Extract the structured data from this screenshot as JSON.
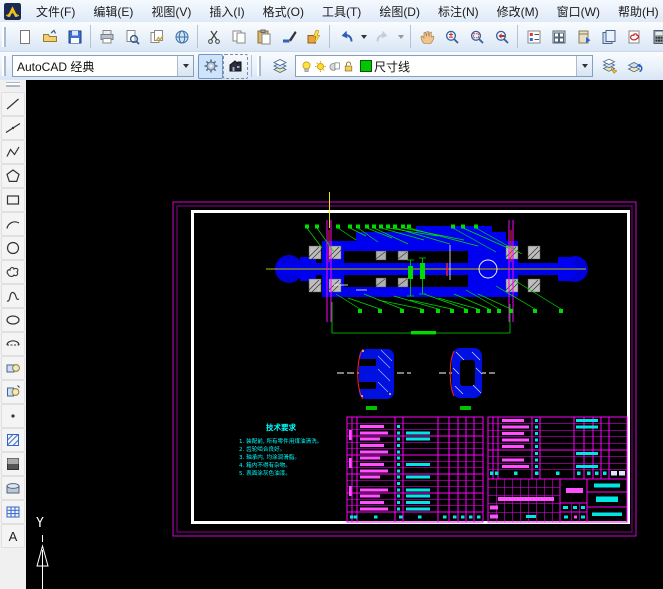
{
  "app": {
    "name": "AutoCAD"
  },
  "menu_bar": {
    "logo_icon": "autocad-logo-icon",
    "items": [
      {
        "id": "file",
        "label": "文件(F)"
      },
      {
        "id": "edit",
        "label": "编辑(E)"
      },
      {
        "id": "view",
        "label": "视图(V)"
      },
      {
        "id": "insert",
        "label": "插入(I)"
      },
      {
        "id": "format",
        "label": "格式(O)"
      },
      {
        "id": "tools",
        "label": "工具(T)"
      },
      {
        "id": "draw",
        "label": "绘图(D)"
      },
      {
        "id": "dimension",
        "label": "标注(N)"
      },
      {
        "id": "modify",
        "label": "修改(M)"
      },
      {
        "id": "window",
        "label": "窗口(W)"
      },
      {
        "id": "help",
        "label": "帮助(H)"
      }
    ]
  },
  "standard_toolbar": {
    "groups": [
      [
        "new",
        "open",
        "save"
      ],
      [
        "plot",
        "plot-preview",
        "publish",
        "publish-web"
      ],
      [
        "cut",
        "copy",
        "paste",
        "match-properties",
        "block-editor"
      ],
      [
        "undo",
        "undo-dropdown",
        "redo",
        "redo-dropdown"
      ],
      [
        "pan",
        "zoom-realtime",
        "zoom-window",
        "zoom-previous"
      ],
      [
        "properties",
        "designcenter",
        "tool-palettes",
        "sheet-set-manager",
        "markup-set-manager",
        "quickcalc"
      ],
      [
        "help"
      ]
    ],
    "disabled": [
      "redo",
      "redo-dropdown"
    ]
  },
  "workspace_toolbar": {
    "workspace_value": "AutoCAD 经典",
    "buttons": [
      "workspace-settings",
      "my-workspace"
    ]
  },
  "layer_toolbar": {
    "left_button": "layer-properties-manager",
    "state_icons": [
      "bulb-on",
      "sun-on",
      "viewport-freeze",
      "lock-open"
    ],
    "layer_color": "#00C800",
    "layer_value": "尺寸线",
    "right_buttons": [
      "layer-states-manager",
      "layer-previous"
    ]
  },
  "draw_toolbar": {
    "icons": [
      "line",
      "construction-line",
      "polyline",
      "polygon",
      "rectangle",
      "arc",
      "circle",
      "revision-cloud",
      "spline",
      "ellipse",
      "ellipse-arc",
      "insert-block",
      "make-block",
      "point",
      "hatch",
      "gradient",
      "region",
      "table",
      "multiline-text"
    ]
  },
  "canvas": {
    "background": "#000000",
    "ucs_label": "Y"
  },
  "drawing": {
    "tech_requirements": {
      "title": "技术要求",
      "items": [
        "1. 装配前, 所有零件用煤油清洗。",
        "2. 齿轮啮合良好。",
        "3. 轴承内, 均涂润滑脂。",
        "4. 箱内不得有杂物。",
        "5. 表面涂灰色油漆。"
      ]
    },
    "colors": {
      "part_outline": "#0000F0",
      "leader": "#00DC00",
      "centerline": "#FFFF00",
      "sheet_border": "#D400D4",
      "sheet_frame": "#FFFFFF",
      "table_grid": "#FF00FF",
      "note_text": "#00FFFF",
      "section_outline": "#FF2020",
      "bearing_hatch": "#BEBEBE"
    }
  }
}
